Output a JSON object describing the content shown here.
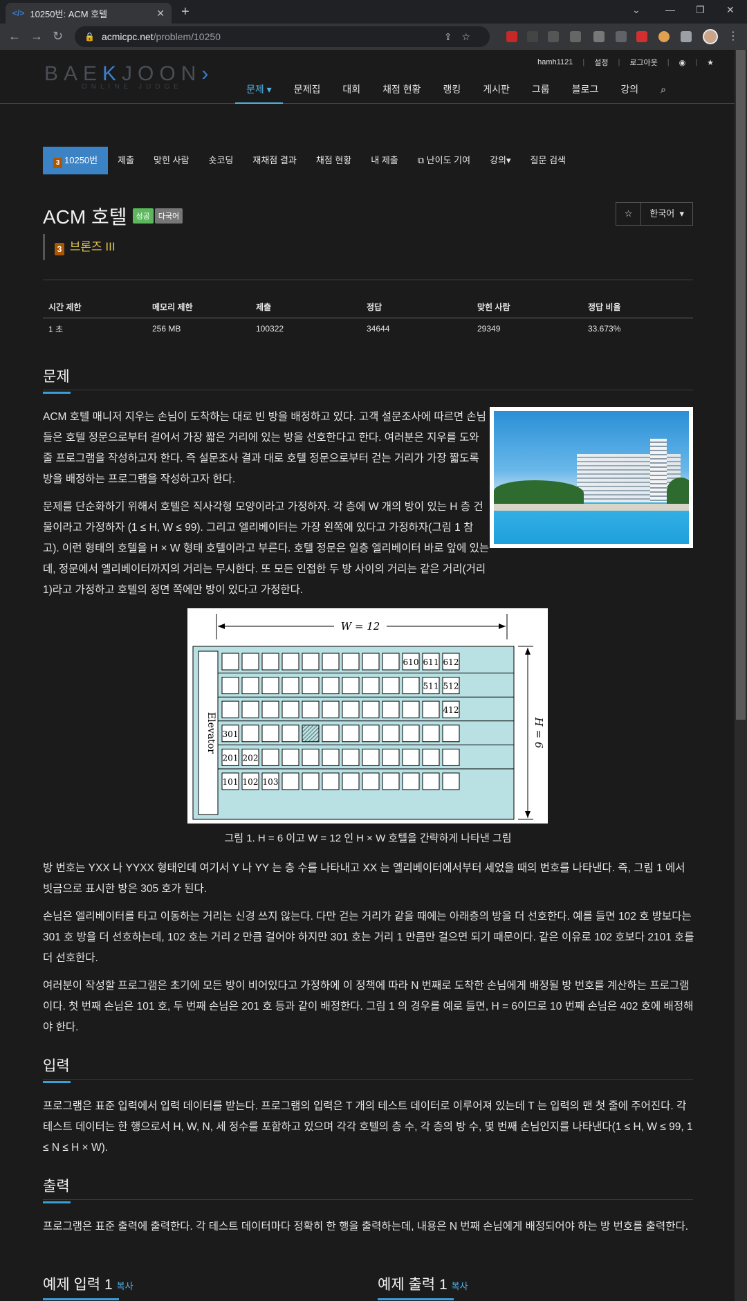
{
  "browser": {
    "tab_title": "10250번: ACM 호텔",
    "tab_favicon": "</>",
    "url_host": "acmicpc.net",
    "url_path": "/problem/10250"
  },
  "header": {
    "logo_main_1": "BAE",
    "logo_main_k": "K",
    "logo_main_2": "JOON",
    "logo_sub": "ONLINE JUDGE",
    "user": "hamh1121",
    "settings": "설정",
    "logout": "로그아웃",
    "nav": [
      "문제",
      "문제집",
      "대회",
      "채점 현황",
      "랭킹",
      "게시판",
      "그룹",
      "블로그",
      "강의"
    ]
  },
  "problem_menu": [
    "10250번",
    "제출",
    "맞힌 사람",
    "숏코딩",
    "재채점 결과",
    "채점 현황",
    "내 제출",
    "난이도 기여",
    "강의",
    "질문 검색"
  ],
  "problem": {
    "title": "ACM 호텔",
    "label_success": "성공",
    "label_multilang": "다국어",
    "tier": "브론즈 III",
    "tier_num": "3",
    "language_btn": "한국어"
  },
  "info": {
    "headers": [
      "시간 제한",
      "메모리 제한",
      "제출",
      "정답",
      "맞힌 사람",
      "정답 비율"
    ],
    "values": [
      "1 초",
      "256 MB",
      "100322",
      "34644",
      "29349",
      "33.673%"
    ]
  },
  "sections": {
    "problem_h": "문제",
    "input_h": "입력",
    "output_h": "출력",
    "p1": "ACM 호텔 매니저 지우는 손님이 도착하는 대로 빈 방을 배정하고 있다. 고객 설문조사에 따르면 손님들은 호텔 정문으로부터 걸어서 가장 짧은 거리에 있는 방을 선호한다고 한다. 여러분은 지우를 도와 줄 프로그램을 작성하고자 한다. 즉 설문조사 결과 대로 호텔 정문으로부터 걷는 거리가 가장 짧도록 방을 배정하는 프로그램을 작성하고자 한다.",
    "p2": "문제를 단순화하기 위해서 호텔은 직사각형 모양이라고 가정하자. 각 층에 W 개의 방이 있는 H 층 건물이라고 가정하자 (1 ≤ H, W ≤ 99). 그리고 엘리베이터는 가장 왼쪽에 있다고 가정하자(그림 1 참고). 이런 형태의 호텔을 H × W 형태 호텔이라고 부른다. 호텔 정문은 일층 엘리베이터 바로 앞에 있는데, 정문에서 엘리베이터까지의 거리는 무시한다. 또 모든 인접한 두 방 사이의 거리는 같은 거리(거리 1)라고 가정하고 호텔의 정면 쪽에만 방이 있다고 가정한다.",
    "fig_caption": "그림 1. H = 6 이고 W = 12 인 H × W 호텔을 간략하게 나타낸 그림",
    "p3": "방 번호는 YXX 나 YYXX 형태인데 여기서 Y 나 YY 는 층 수를 나타내고 XX 는 엘리베이터에서부터 세었을 때의 번호를 나타낸다. 즉, 그림 1 에서 빗금으로 표시한 방은 305 호가 된다.",
    "p4": "손님은 엘리베이터를 타고 이동하는 거리는 신경 쓰지 않는다. 다만 걷는 거리가 같을 때에는 아래층의 방을 더 선호한다. 예를 들면 102 호 방보다는 301 호 방을 더 선호하는데, 102 호는 거리 2 만큼 걸어야 하지만 301 호는 거리 1 만큼만 걸으면 되기 때문이다. 같은 이유로 102 호보다 2101 호를 더 선호한다.",
    "p5": "여러분이 작성할 프로그램은 초기에 모든 방이 비어있다고 가정하에 이 정책에 따라 N 번째로 도착한 손님에게 배정될 방 번호를 계산하는 프로그램이다. 첫 번째 손님은 101 호, 두 번째 손님은 201 호 등과 같이 배정한다. 그림 1 의 경우를 예로 들면, H = 6이므로 10 번째 손님은 402 호에 배정해야 한다.",
    "input_p": "프로그램은 표준 입력에서 입력 데이터를 받는다. 프로그램의 입력은 T 개의 테스트 데이터로 이루어져 있는데 T 는 입력의 맨 첫 줄에 주어진다. 각 테스트 데이터는 한 행으로서 H, W, N, 세 정수를 포함하고 있으며 각각 호텔의 층 수, 각 층의 방 수, 몇 번째 손님인지를 나타낸다(1 ≤ H, W ≤ 99, 1 ≤ N ≤ H × W).",
    "output_p": "프로그램은 표준 출력에 출력한다. 각 테스트 데이터마다 정확히 한 행을 출력하는데, 내용은 N 번째 손님에게 배정되어야 하는 방 번호를 출력한다.",
    "sample_in": "예제 입력 1",
    "sample_out": "예제 출력 1",
    "copy": "복사"
  },
  "figure": {
    "w_label": "W = 12",
    "h_label": "H = 6",
    "elevator": "Elevator",
    "rooms": {
      "r6": [
        "610",
        "611",
        "612"
      ],
      "r5": [
        "511",
        "512"
      ],
      "r4": [
        "412"
      ],
      "r3": [
        "301"
      ],
      "r2": [
        "201",
        "202"
      ],
      "r1": [
        "101",
        "102",
        "103"
      ]
    }
  },
  "colors": {
    "accent": "#3b83c4",
    "tier_bronze": "#ad5600",
    "success": "#5cb85c",
    "fig_fill": "#b9e0e2"
  }
}
